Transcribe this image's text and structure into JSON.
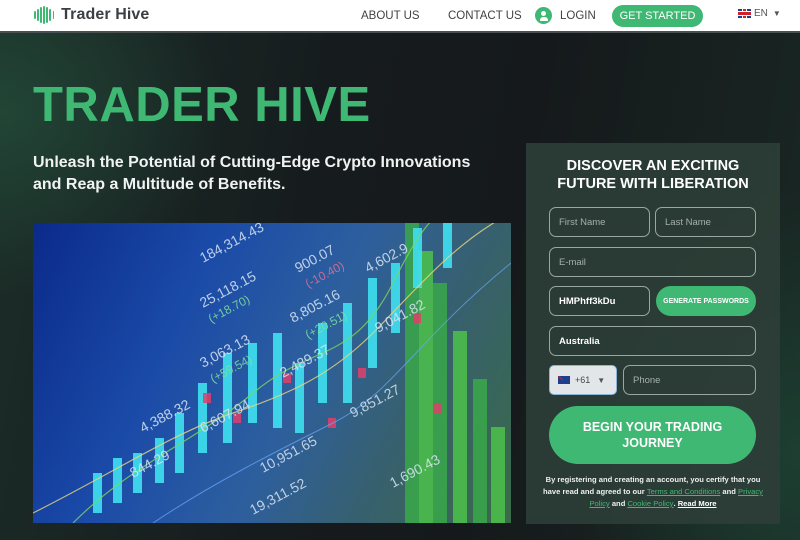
{
  "header": {
    "brand": "Trader Hive",
    "nav": {
      "about": "ABOUT US",
      "contact": "CONTACT US",
      "login": "LOGIN",
      "get_started": "GET STARTED"
    },
    "language": {
      "code": "EN",
      "flag": "uk-flag-icon"
    }
  },
  "hero": {
    "title": "TRADER HIVE",
    "subtitle": "Unleash the Potential of Cutting-Edge Crypto Innovations and Reap a Multitude of Benefits.",
    "image_alt": "Stock market trading board with candlestick chart",
    "image_numbers": [
      "184,314.43",
      "25,118.15",
      "(+18.70)",
      "3,063.13",
      "(+59.54)",
      "900.07",
      "(-10.40)",
      "8,805.16",
      "(+20.51)",
      "2,489.37",
      "4,602.9",
      "9,041.82",
      "6,607.94",
      "4,388.32",
      "844.29",
      "10,951.65",
      "19,311.52",
      "9,851.27",
      "1,690.43"
    ]
  },
  "form": {
    "title_line1": "DISCOVER AN EXCITING",
    "title_line2": "FUTURE WITH LIBERATION",
    "first_name_placeholder": "First Name",
    "last_name_placeholder": "Last Name",
    "email_placeholder": "E-mail",
    "password_value": "HMPhff3kDu",
    "generate_label": "GENERATE PASSWORDS",
    "country_value": "Australia",
    "phone_code": "+61",
    "phone_placeholder": "Phone",
    "submit_label": "BEGIN YOUR TRADING JOURNEY",
    "disclaimer": {
      "text1": "By registering and creating an account, you certify that you have read and agreed to our ",
      "terms": "Terms and Conditions",
      "text2": " and ",
      "privacy": "Privacy Policy",
      "text3": " and ",
      "cookie": "Cookie Policy",
      "text4": ". ",
      "read_more": "Read More"
    }
  },
  "colors": {
    "brand_green": "#3fb874",
    "background_dark": "#15191b",
    "panel": "#2c3e37"
  }
}
